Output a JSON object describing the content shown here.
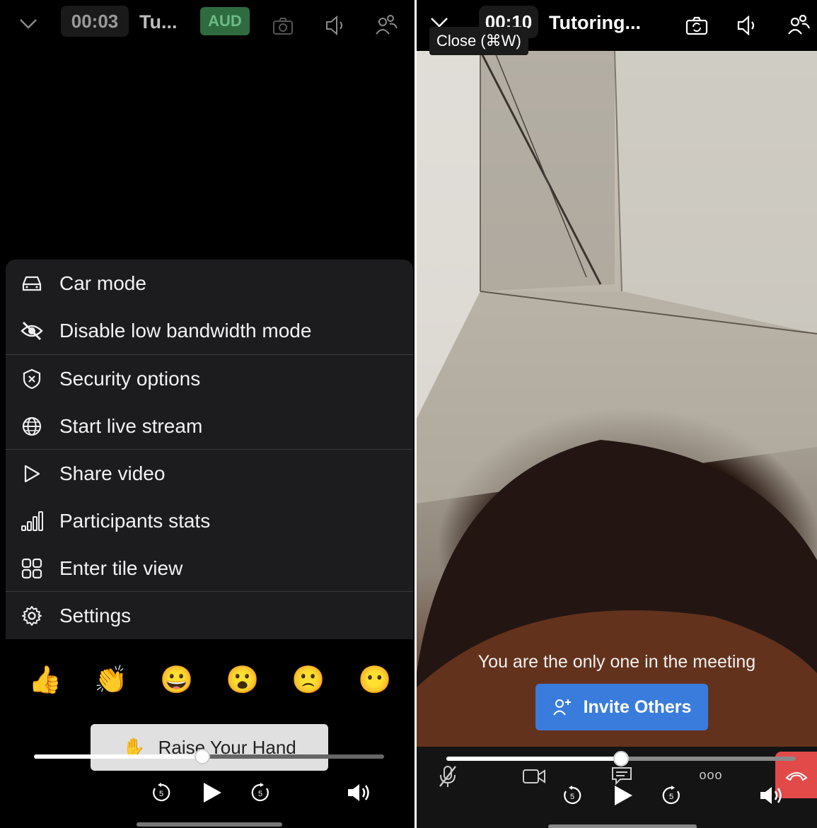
{
  "left_screen": {
    "timer": "00:03",
    "title": "Tu...",
    "audio_badge": "AUD",
    "menu_items": [
      {
        "label": "Car mode",
        "icon": "car-icon"
      },
      {
        "label": "Disable low bandwidth mode",
        "icon": "eye-slash-icon"
      },
      {
        "label": "Security options",
        "icon": "shield-icon"
      },
      {
        "label": "Start live stream",
        "icon": "globe-icon"
      },
      {
        "label": "Share video",
        "icon": "play-outline-icon"
      },
      {
        "label": "Participants stats",
        "icon": "bar-chart-icon"
      },
      {
        "label": "Enter tile view",
        "icon": "grid-icon"
      },
      {
        "label": "Settings",
        "icon": "gear-icon"
      }
    ],
    "reactions": [
      "👍",
      "👏",
      "😀",
      "😮",
      "🙁",
      "😶"
    ],
    "raise_hand_label": "Raise Your Hand",
    "raise_hand_emoji": "✋",
    "scrub_progress": 0.48
  },
  "right_screen": {
    "timer": "00:10",
    "title": "Tutoring...",
    "tooltip": "Close (⌘W)",
    "only_one_message": "You are the only one in the meeting",
    "invite_label": "Invite Others",
    "scrub_progress": 0.5,
    "more_label": "ooo"
  },
  "colors": {
    "menu_bg": "#1c1c1e",
    "invite_blue": "#3a7cdb",
    "hangup_red": "#e24a4a",
    "aud_green": "#2e6b3e"
  }
}
